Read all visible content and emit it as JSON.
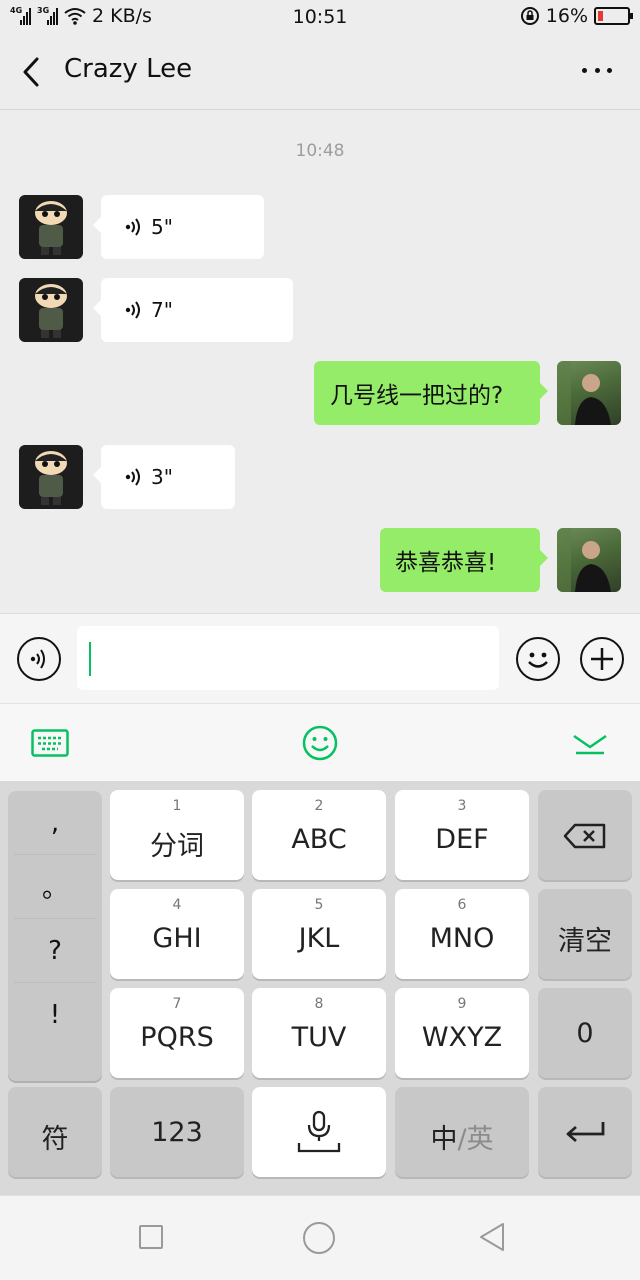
{
  "status_bar": {
    "network_1": "4G",
    "network_2": "3G",
    "speed": "2 KB/s",
    "time": "10:51",
    "battery": "16%",
    "battery_level": 0.16
  },
  "header": {
    "title": "Crazy Lee"
  },
  "chat": {
    "timestamp": "10:48",
    "messages": [
      {
        "side": "left",
        "kind": "voice",
        "duration": "5\""
      },
      {
        "side": "left",
        "kind": "voice",
        "duration": "7\""
      },
      {
        "side": "right",
        "kind": "text",
        "text": "几号线一把过的?"
      },
      {
        "side": "left",
        "kind": "voice",
        "duration": "3\""
      },
      {
        "side": "right",
        "kind": "text",
        "text": "恭喜恭喜!"
      }
    ]
  },
  "keyboard": {
    "punctuation": [
      ",",
      "。",
      "?",
      "!"
    ],
    "keys": [
      {
        "num": "1",
        "label": "分词"
      },
      {
        "num": "2",
        "label": "ABC"
      },
      {
        "num": "3",
        "label": "DEF"
      },
      {
        "num": "4",
        "label": "GHI"
      },
      {
        "num": "5",
        "label": "JKL"
      },
      {
        "num": "6",
        "label": "MNO"
      },
      {
        "num": "7",
        "label": "PQRS"
      },
      {
        "num": "8",
        "label": "TUV"
      },
      {
        "num": "9",
        "label": "WXYZ"
      }
    ],
    "clear_label": "清空",
    "zero_label": "0",
    "symbol_label": "符",
    "numbers_label": "123",
    "lang_primary": "中",
    "lang_secondary": "/英"
  },
  "colors": {
    "accent_green": "#07c160",
    "bubble_green": "#95ec69",
    "battery_red": "#e53935"
  },
  "icons": [
    "back-icon",
    "more-icon",
    "voice-icon",
    "emoji-icon",
    "plus-icon",
    "keyboard-icon",
    "collapse-icon",
    "backspace-icon",
    "mic-icon",
    "enter-icon"
  ]
}
